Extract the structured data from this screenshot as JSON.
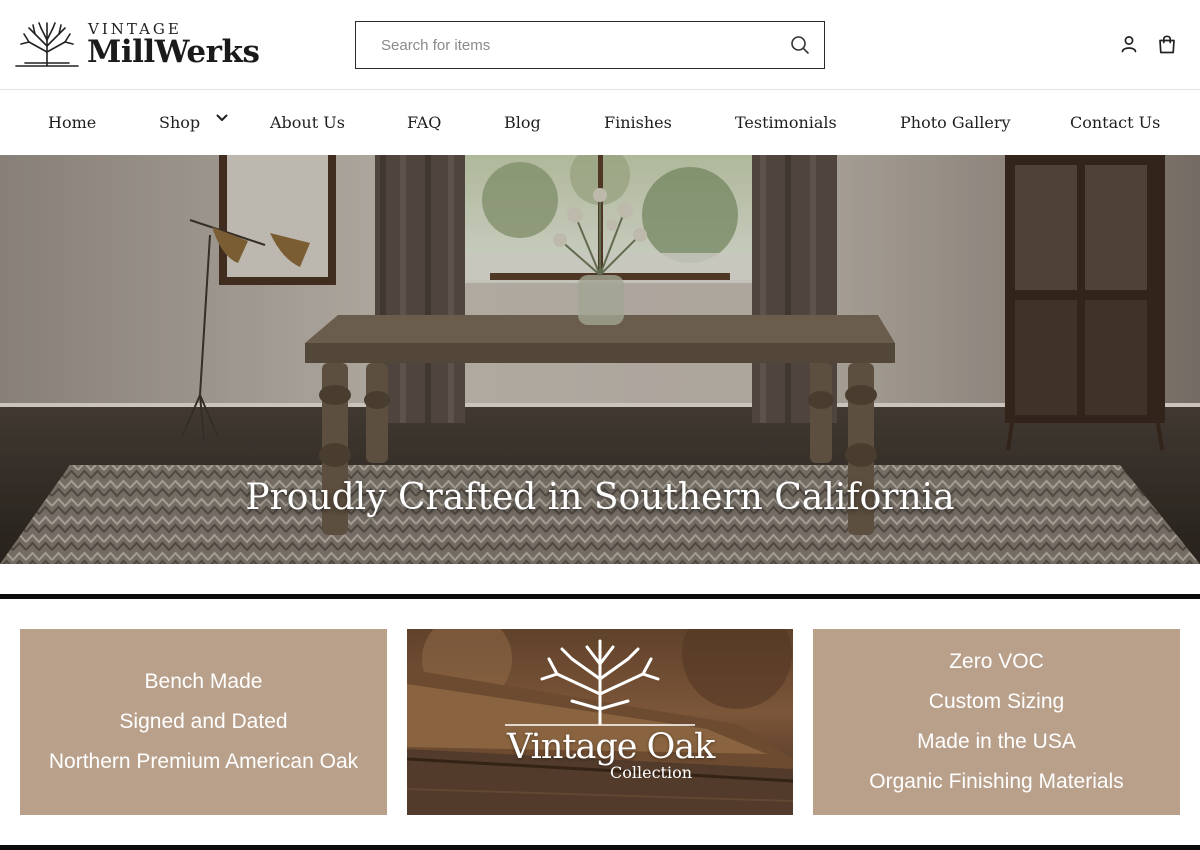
{
  "brand": {
    "logo_top": "VINTAGE",
    "logo_main": "MillWerks"
  },
  "search": {
    "placeholder": "Search for items"
  },
  "nav": {
    "items": [
      {
        "label": "Home"
      },
      {
        "label": "Shop"
      },
      {
        "label": "About Us"
      },
      {
        "label": "FAQ"
      },
      {
        "label": "Blog"
      },
      {
        "label": "Finishes"
      },
      {
        "label": "Testimonials"
      },
      {
        "label": "Photo Gallery"
      },
      {
        "label": "Contact Us"
      }
    ]
  },
  "hero": {
    "title": "Proudly Crafted in Southern California"
  },
  "features": {
    "left": [
      "Bench Made",
      "Signed and Dated",
      "Northern Premium American Oak"
    ],
    "right": [
      "Zero VOC",
      "Custom Sizing",
      "Made in the USA",
      "Organic Finishing Materials"
    ]
  },
  "promo": {
    "title": "Vintage Oak",
    "subtitle": "Collection"
  },
  "colors": {
    "feature_bg": "#b9a08b",
    "text_dark": "#1f1f1f",
    "rule": "#0c0c0c"
  },
  "icons": [
    "tree-logo-icon",
    "search-icon",
    "account-icon",
    "cart-bag-icon",
    "chevron-down-icon",
    "tree-emblem-icon"
  ]
}
